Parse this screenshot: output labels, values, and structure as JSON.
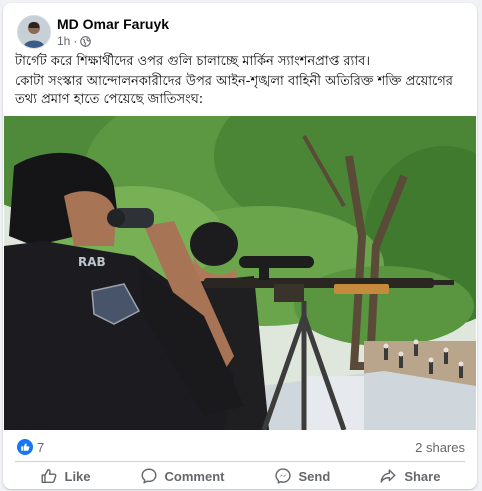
{
  "post": {
    "author": "MD Omar Faruyk",
    "time": "1h",
    "separator": "·",
    "audience_icon": "globe-icon",
    "headline": "টার্গেট করে শিক্ষার্থীদের ওপর গুলি চালাচ্ছে মার্কিন স্যাংশনপ্রাপ্ত র‍্যাব।",
    "body": "কোটা সংস্কার আন্দোলনকারীদের উপর আইন-শৃঙ্খলা বাহিনী অতিরিক্ত শক্তি প্রয়োগের তথ্য প্রমাণ হাতে পেয়েছে জাতিসংঘ:",
    "photo_vest_text": "RAB"
  },
  "stats": {
    "reaction_icon": "like-icon",
    "reaction_count": "7",
    "shares": "2 shares"
  },
  "actions": {
    "like": "Like",
    "comment": "Comment",
    "send": "Send",
    "share": "Share"
  },
  "colors": {
    "accent": "#1877f2",
    "secondary_text": "#65676b",
    "divider": "#ced0d4"
  }
}
